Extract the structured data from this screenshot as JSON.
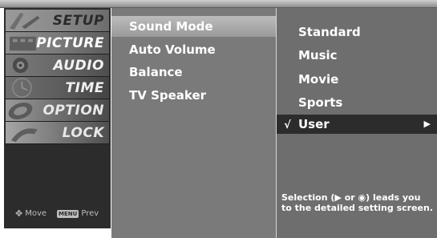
{
  "left_menu": {
    "items": [
      {
        "label": "SETUP"
      },
      {
        "label": "PICTURE"
      },
      {
        "label": "AUDIO"
      },
      {
        "label": "TIME"
      },
      {
        "label": "OPTION"
      },
      {
        "label": "LOCK"
      }
    ],
    "nav": {
      "move_label": "Move",
      "prev_key": "MENU",
      "prev_label": "Prev"
    }
  },
  "submenu": {
    "items": [
      {
        "label": "Sound Mode"
      },
      {
        "label": "Auto Volume"
      },
      {
        "label": "Balance"
      },
      {
        "label": "TV Speaker"
      }
    ],
    "active_index": 0
  },
  "options": {
    "items": [
      {
        "label": "Standard"
      },
      {
        "label": "Music"
      },
      {
        "label": "Movie"
      },
      {
        "label": "Sports"
      },
      {
        "label": "User"
      }
    ],
    "selected_check": "√",
    "selected_arrow": "▶",
    "hint": "Selection (▶ or ◉) leads you to the detailed setting screen."
  },
  "colors": {
    "left_bg": "#2c2c2c",
    "submenu_bg": "#7a7a7a",
    "options_bg": "#6e6e6e",
    "selected_bg": "#2c2c2c",
    "text": "#ffffff"
  }
}
